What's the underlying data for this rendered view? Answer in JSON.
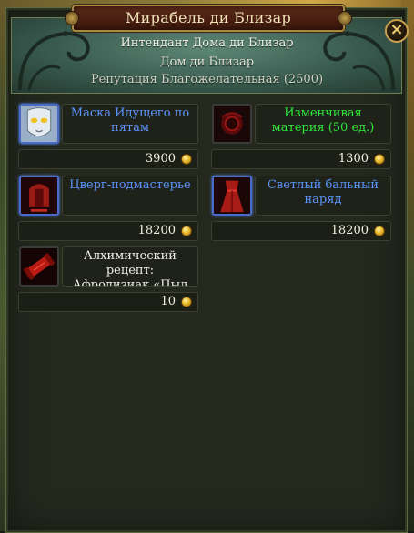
{
  "window": {
    "title": "Мирабель ди Близар",
    "close_symbol": "×"
  },
  "header": {
    "npc_title": "Интендант Дома ди Близар",
    "faction": "Дом ди Близар",
    "reputation": "Репутация Благожелательная (2500)"
  },
  "items": [
    {
      "name": "Маска Идущего по пятам",
      "price": "3900",
      "quality_color": "#5a96ff",
      "icon": "mask-icon"
    },
    {
      "name": "Изменчивая материя (50 ед.)",
      "price": "1300",
      "quality_color": "#2ee83a",
      "icon": "matter-icon"
    },
    {
      "name": "Цверг-подмастерье",
      "price": "18200",
      "quality_color": "#5a96ff",
      "icon": "dwarf-armor-icon"
    },
    {
      "name": "Светлый бальный наряд",
      "price": "18200",
      "quality_color": "#5a96ff",
      "icon": "ball-gown-icon"
    },
    {
      "name": "Алхимический рецепт: Афродизиак «Пыл",
      "price": "10",
      "quality_color": "#f0f0ea",
      "icon": "recipe-scroll-icon"
    }
  ]
}
